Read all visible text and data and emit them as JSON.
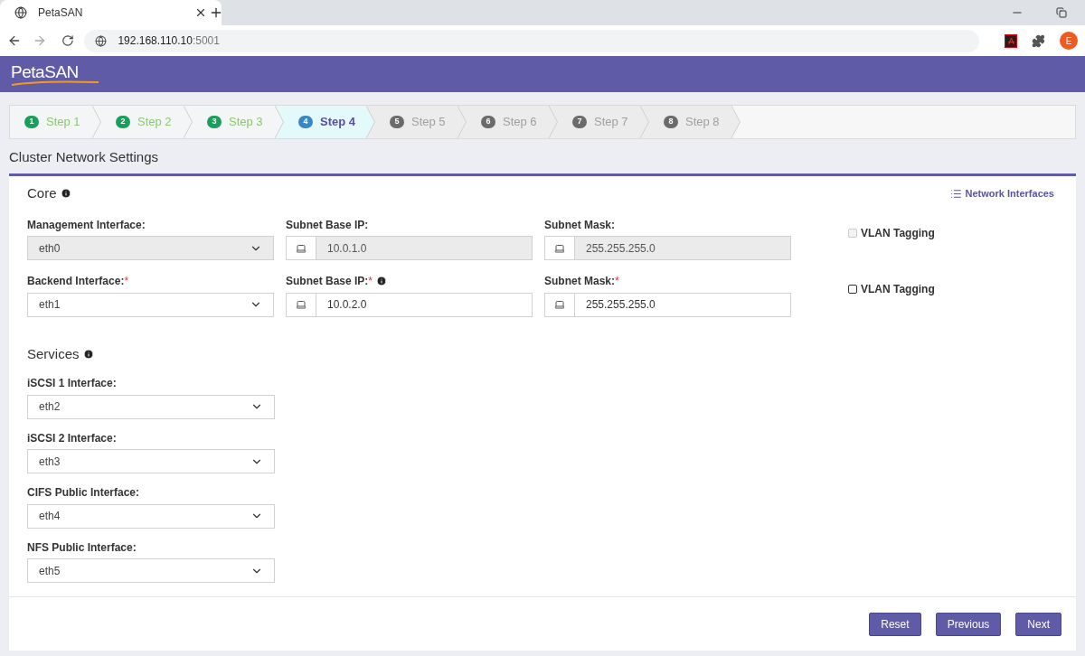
{
  "browser": {
    "tab_title": "PetaSAN",
    "url_host": "192.168.110.10",
    "url_port": ":5001",
    "profile_initial": "E"
  },
  "header": {
    "logo": "PetaSAN"
  },
  "steps": [
    {
      "number": "1",
      "label": "Step 1",
      "completed": true,
      "selected": false
    },
    {
      "number": "2",
      "label": "Step 2",
      "completed": true,
      "selected": false
    },
    {
      "number": "3",
      "label": "Step 3",
      "completed": true,
      "selected": false
    },
    {
      "number": "4",
      "label": "Step 4",
      "completed": false,
      "selected": true
    },
    {
      "number": "5",
      "label": "Step 5",
      "completed": false,
      "selected": false
    },
    {
      "number": "6",
      "label": "Step 6",
      "completed": false,
      "selected": false
    },
    {
      "number": "7",
      "label": "Step 7",
      "completed": false,
      "selected": false
    },
    {
      "number": "8",
      "label": "Step 8",
      "completed": false,
      "selected": false
    }
  ],
  "page_title": "Cluster Network Settings",
  "core": {
    "heading": "Core",
    "link": "Network Interfaces",
    "rows": [
      {
        "interface": {
          "label": "Management Interface:",
          "disabled": true,
          "value": "eth0"
        },
        "subnet": {
          "label": "Subnet Base IP:",
          "info": false,
          "disabled": true,
          "value": "10.0.1.0"
        },
        "mask": {
          "label": "Subnet Mask:",
          "disabled": true,
          "value": "255.255.255.0"
        },
        "vlan": {
          "label": "VLAN Tagging",
          "checked": false,
          "disabled": true
        }
      },
      {
        "interface": {
          "label": "Backend Interface:",
          "required_mark": "*",
          "disabled": false,
          "value": "eth1"
        },
        "subnet": {
          "label": "Subnet Base IP:",
          "required_mark": "*",
          "info": true,
          "disabled": false,
          "value": "10.0.2.0"
        },
        "mask": {
          "label": "Subnet Mask:",
          "required_mark": "*",
          "disabled": false,
          "value": "255.255.255.0"
        },
        "vlan": {
          "label": "VLAN Tagging",
          "checked": false,
          "disabled": false
        }
      }
    ]
  },
  "services": {
    "heading": "Services",
    "fields": [
      {
        "label": "iSCSI 1 Interface:",
        "value": "eth2"
      },
      {
        "label": "iSCSI 2 Interface:",
        "value": "eth3"
      },
      {
        "label": "CIFS Public Interface:",
        "value": "eth4"
      },
      {
        "label": "NFS Public Interface:",
        "value": "eth5"
      }
    ]
  },
  "buttons": [
    "Reset",
    "Previous",
    "Next"
  ]
}
